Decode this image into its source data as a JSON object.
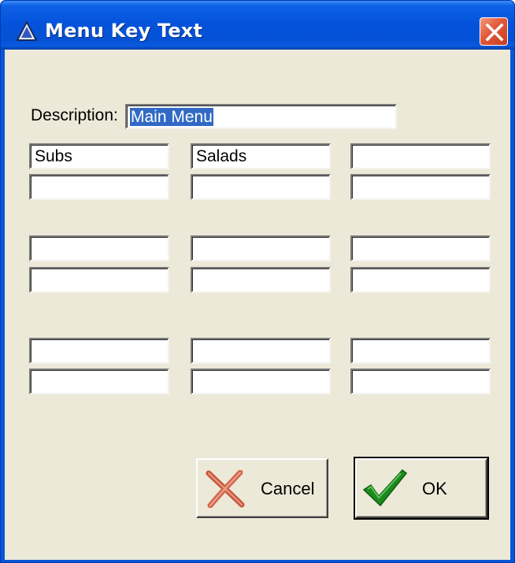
{
  "window": {
    "title": "Menu Key Text",
    "close_glyph": "close-icon",
    "app_icon": "triangle-app-icon"
  },
  "description": {
    "label": "Description:",
    "value": "Main Menu"
  },
  "key_fields": [
    "Subs",
    "Salads",
    "",
    "",
    "",
    "",
    "",
    "",
    "",
    "",
    "",
    "",
    "",
    "",
    "",
    "",
    "",
    ""
  ],
  "buttons": {
    "cancel_label": "Cancel",
    "cancel_icon": "red-x-icon",
    "ok_label": "OK",
    "ok_icon": "green-check-icon"
  },
  "colors": {
    "titlebar": "#0553dc",
    "client_bg": "#ece9d8",
    "selection": "#316ac5",
    "close_button": "#e2583a"
  }
}
